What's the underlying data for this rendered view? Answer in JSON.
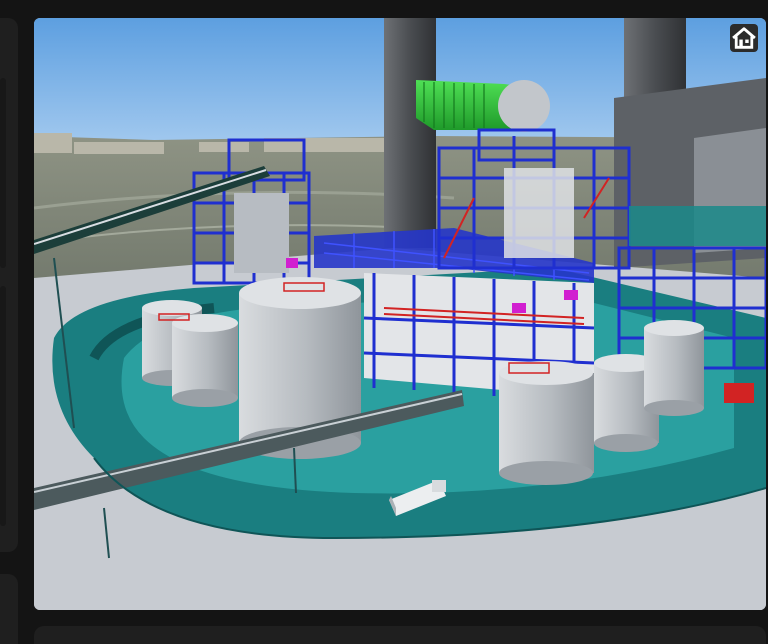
{
  "viewer": {
    "home_button_icon": "home-icon"
  },
  "colors": {
    "steel_structure": "#1f2fd0",
    "ground_pad": "#1a7e80",
    "duct_green": "#2fbf3a",
    "sky": "#7fb6e6"
  }
}
